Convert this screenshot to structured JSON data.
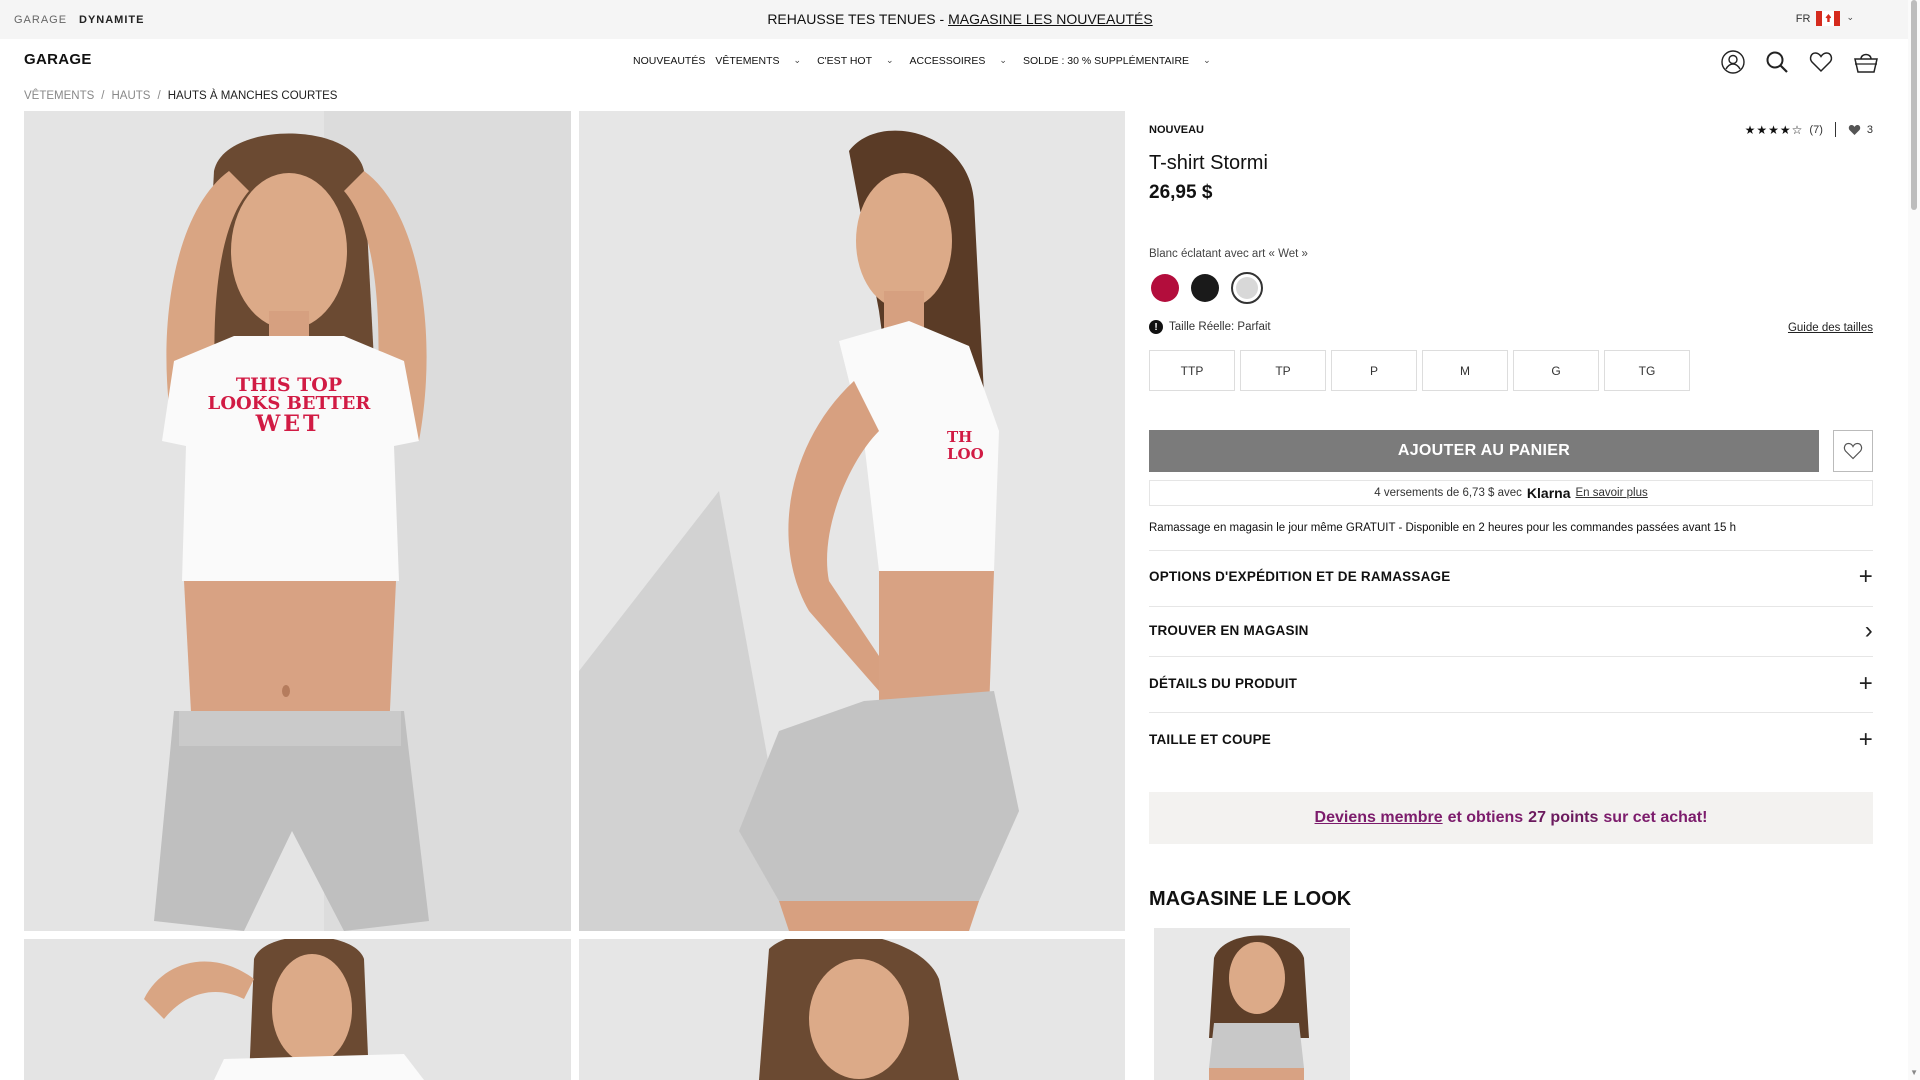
{
  "topbar": {
    "brands": [
      "GARAGE",
      "DYNAMITE"
    ],
    "promo_text": "REHAUSSE TES TENUES - ",
    "promo_link": "MAGASINE LES NOUVEAUTÉS",
    "language": "FR",
    "flag_icon": "canada-flag-icon"
  },
  "header": {
    "logo": "GARAGE",
    "nav": [
      {
        "label": "NOUVEAUTÉS",
        "has_menu": false
      },
      {
        "label": "VÊTEMENTS",
        "has_menu": true
      },
      {
        "label": "C'EST HOT",
        "has_menu": true
      },
      {
        "label": "ACCESSOIRES",
        "has_menu": true
      },
      {
        "label": "SOLDE : 30 % SUPPLÉMENTAIRE",
        "has_menu": true
      }
    ],
    "icons": [
      "account-icon",
      "search-icon",
      "heart-icon",
      "bag-icon"
    ]
  },
  "breadcrumb": [
    "VÊTEMENTS",
    "/",
    "HAUTS",
    "/",
    "HAUTS À MANCHES COURTES"
  ],
  "gallery": {
    "shirt_print": [
      "THIS TOP",
      "LOOKS BETTER",
      "WET"
    ],
    "side_print": [
      "TH",
      "LOO"
    ]
  },
  "product": {
    "badge": "NOUVEAU",
    "rating_stars": "★★★★☆",
    "rating_count": "(7)",
    "wishlist_count": "3",
    "title": "T-shirt Stormi",
    "price": "26,95 $",
    "color_label": "Blanc éclatant avec art « Wet »",
    "swatches": [
      {
        "name": "red",
        "color": "#b30d3c"
      },
      {
        "name": "black",
        "color": "#1a1a1a"
      },
      {
        "name": "white",
        "color": "#d8d8d8",
        "selected": true
      }
    ],
    "fit_icon": "!",
    "fit_text": "Taille Réelle: Parfait",
    "size_guide": "Guide des tailles",
    "sizes": [
      "TTP",
      "TP",
      "P",
      "M",
      "G",
      "TG"
    ],
    "add_to_cart": "AJOUTER AU PANIER",
    "klarna_text": "4 versements de 6,73 $ avec",
    "klarna_brand": "Klarna",
    "klarna_link": "En savoir plus",
    "pickup_text": "Ramassage en magasin le jour même GRATUIT - Disponible en 2 heures pour les commandes passées avant 15 h",
    "accordions": [
      {
        "label": "OPTIONS D'EXPÉDITION ET DE RAMASSAGE",
        "symbol": "+"
      },
      {
        "label": "TROUVER EN MAGASIN",
        "symbol": "›"
      },
      {
        "label": "DÉTAILS DU PRODUIT",
        "symbol": "+"
      },
      {
        "label": "TAILLE ET COUPE",
        "symbol": "+"
      }
    ],
    "member_link": "Deviens membre",
    "member_text_1": "et obtiens",
    "member_points": "27 points",
    "member_text_2": "sur cet achat!",
    "shop_look": "MAGASINE LE LOOK"
  }
}
